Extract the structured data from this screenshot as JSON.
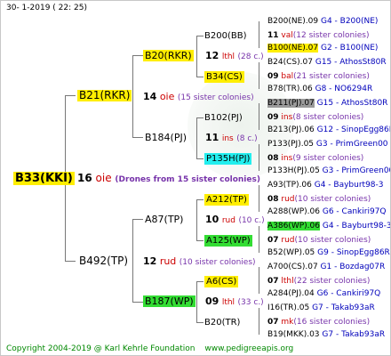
{
  "header": {
    "date": "30-   1-2019  (  22:  25)"
  },
  "footer": {
    "copyright": "Copyright 2004-2019 @ Karl Kehrle Foundation",
    "site": "www.pedigreeapis.org"
  },
  "root": {
    "name": "B33(KKI)",
    "year": "16",
    "line": "oie",
    "note": "(Drones from 15 sister colonies)"
  },
  "gen2": [
    {
      "name": "B21(RKR)",
      "year": "14",
      "line": "oie",
      "note": "(15 sister colonies)"
    },
    {
      "name": "B492(TP)",
      "year": "12",
      "line": "rud",
      "note": "(10 sister colonies)"
    }
  ],
  "gen3": [
    {
      "name": "B20(RKR)",
      "year": "12",
      "line": "lthl",
      "note": "(28 c.)"
    },
    {
      "name": "B184(PJ)",
      "year": "11",
      "line": "ins",
      "note": "(8 c.)"
    },
    {
      "name": "A87(TP)",
      "year": "10",
      "line": "rud",
      "note": "(10 c.)"
    },
    {
      "name": "B187(WP)",
      "year": "09",
      "line": "lthl",
      "note": "(33 c.)"
    }
  ],
  "gen4": [
    {
      "name": "B200(BB)",
      "year": "11",
      "line": "val",
      "note": "(12 sister colonies)"
    },
    {
      "name": "B34(CS)",
      "year": "09",
      "line": "bal",
      "note": "(21 sister colonies)"
    },
    {
      "name": "B102(PJ)",
      "year": "09",
      "line": "ins",
      "note": "(8 sister colonies)"
    },
    {
      "name": "P135H(PJ)",
      "year": "08",
      "line": "ins",
      "note": "(9 sister colonies)"
    },
    {
      "name": "A212(TP)",
      "year": "08",
      "line": "rud",
      "note": "(10 sister colonies)"
    },
    {
      "name": "A125(WP)",
      "year": "07",
      "line": "rud",
      "note": "(10 sister colonies)"
    },
    {
      "name": "A6(CS)",
      "year": "07",
      "line": "lthl",
      "note": "(22 sister colonies)"
    },
    {
      "name": "B20(TR)",
      "year": "07",
      "line": "mk",
      "note": "(16 sister colonies)"
    }
  ],
  "gen5": [
    {
      "name": "B200(NE).09",
      "ref": "G4 - B200(NE)"
    },
    {
      "name": "B100(NE).07",
      "ref": "G2 - B100(NE)"
    },
    {
      "name": "B24(CS).07",
      "ref": "G15 - AthosSt80R"
    },
    {
      "name": "B78(TR).06",
      "ref": "G8 - NO6294R"
    },
    {
      "name": "B211(PJ).07",
      "ref": "G15 - AthosSt80R"
    },
    {
      "name": "B213(PJ).06",
      "ref": "G12 - SinopEgg86R"
    },
    {
      "name": "P133(PJ).05",
      "ref": "G3 - PrimGreen00"
    },
    {
      "name": "P133H(PJ).05",
      "ref": "G3 - PrimGreen00"
    },
    {
      "name": "A93(TP).06",
      "ref": "G4 - Bayburt98-3"
    },
    {
      "name": "A288(WP).06",
      "ref": "G6 - Cankiri97Q"
    },
    {
      "name": "A386(WP).06",
      "ref": "G4 - Bayburt98-3"
    },
    {
      "name": "B52(WP).05",
      "ref": "G9 - SinopEgg86R"
    },
    {
      "name": "A700(CS).07",
      "ref": "G1 - Bozdag07R"
    },
    {
      "name": "A284(PJ).04",
      "ref": "G6 - Cankiri97Q"
    },
    {
      "name": "I16(TR).05",
      "ref": "G7 - Takab93aR"
    },
    {
      "name": "B19(MKK).03",
      "ref": "G7 - Takab93aR"
    }
  ]
}
